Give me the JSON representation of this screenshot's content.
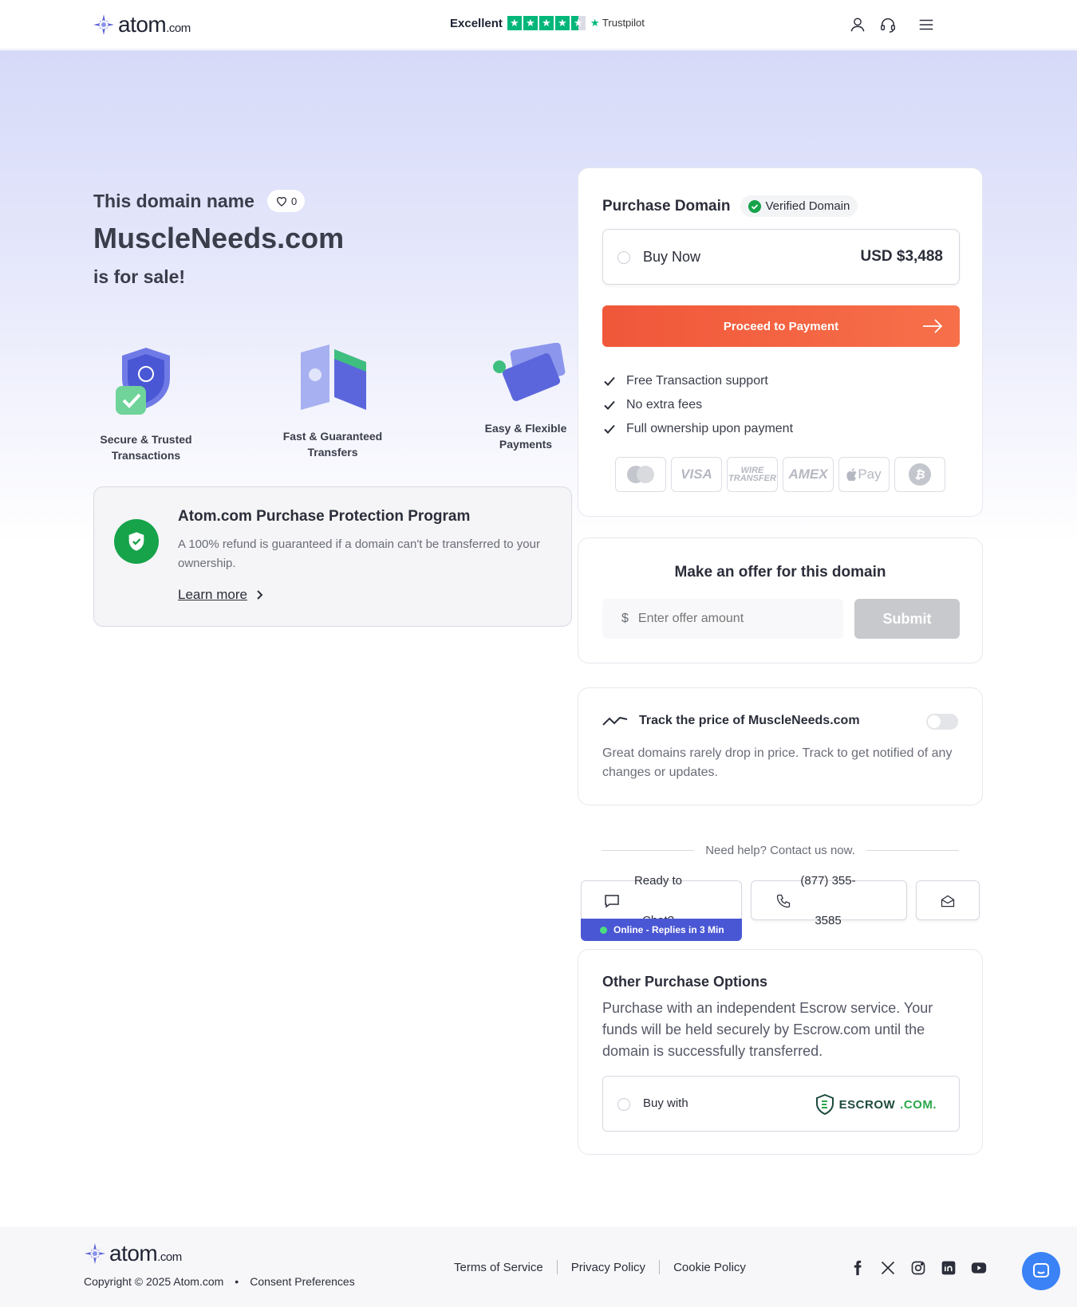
{
  "header": {
    "logo_word": "atom",
    "logo_suffix": ".com",
    "trust_rating": "Excellent",
    "trust_brand": "Trustpilot",
    "stars": 4.5
  },
  "hero": {
    "intro": "This domain name",
    "like_count": "0",
    "domain": "MuscleNeeds.com",
    "for_sale": "is for sale!"
  },
  "features": [
    {
      "label": "Secure & Trusted Transactions"
    },
    {
      "label": "Fast & Guaranteed Transfers"
    },
    {
      "label": "Easy & Flexible Payments"
    }
  ],
  "protection": {
    "title": "Atom.com Purchase Protection Program",
    "description": "A 100% refund is guaranteed if a domain can't be transferred to your ownership.",
    "link": "Learn more"
  },
  "purchase": {
    "title": "Purchase Domain",
    "verified": "Verified Domain",
    "option_label": "Buy Now",
    "price": "USD $3,488",
    "cta": "Proceed to Payment",
    "benefits": [
      "Free Transaction support",
      "No extra fees",
      "Full ownership upon payment"
    ],
    "payment_methods": [
      "mastercard",
      "VISA",
      "WIRE TRANSFER",
      "AMEX",
      "Pay",
      "bitcoin"
    ]
  },
  "offer": {
    "title": "Make an offer for this domain",
    "currency": "$",
    "placeholder": "Enter offer amount",
    "submit": "Submit"
  },
  "track": {
    "title": "Track the price of MuscleNeeds.com",
    "description": "Great domains rarely drop in price. Track to get notified of any changes or updates.",
    "enabled": false
  },
  "help": {
    "label": "Need help? Contact us now.",
    "chat": "Ready to Chat?",
    "online": "Online - Replies in 3 Min",
    "phone": "(877) 355-3585"
  },
  "other": {
    "title": "Other Purchase Options",
    "description": "Purchase with an independent Escrow service. Your funds will be held securely by Escrow.com until the domain is successfully transferred.",
    "option_label": "Buy with",
    "escrow_name": "ESCROW",
    "escrow_suffix": ".COM."
  },
  "footer": {
    "copyright": "Copyright © 2025 Atom.com",
    "bullet": "•",
    "consent": "Consent Preferences",
    "links": [
      "Terms of Service",
      "Privacy Policy",
      "Cookie Policy"
    ],
    "social": [
      "facebook-icon",
      "x-icon",
      "instagram-icon",
      "linkedin-icon",
      "youtube-icon"
    ]
  },
  "colors": {
    "accent": "#f0573a",
    "brand": "#4a57d4",
    "success": "#16a34a",
    "trust": "#00b67a"
  }
}
